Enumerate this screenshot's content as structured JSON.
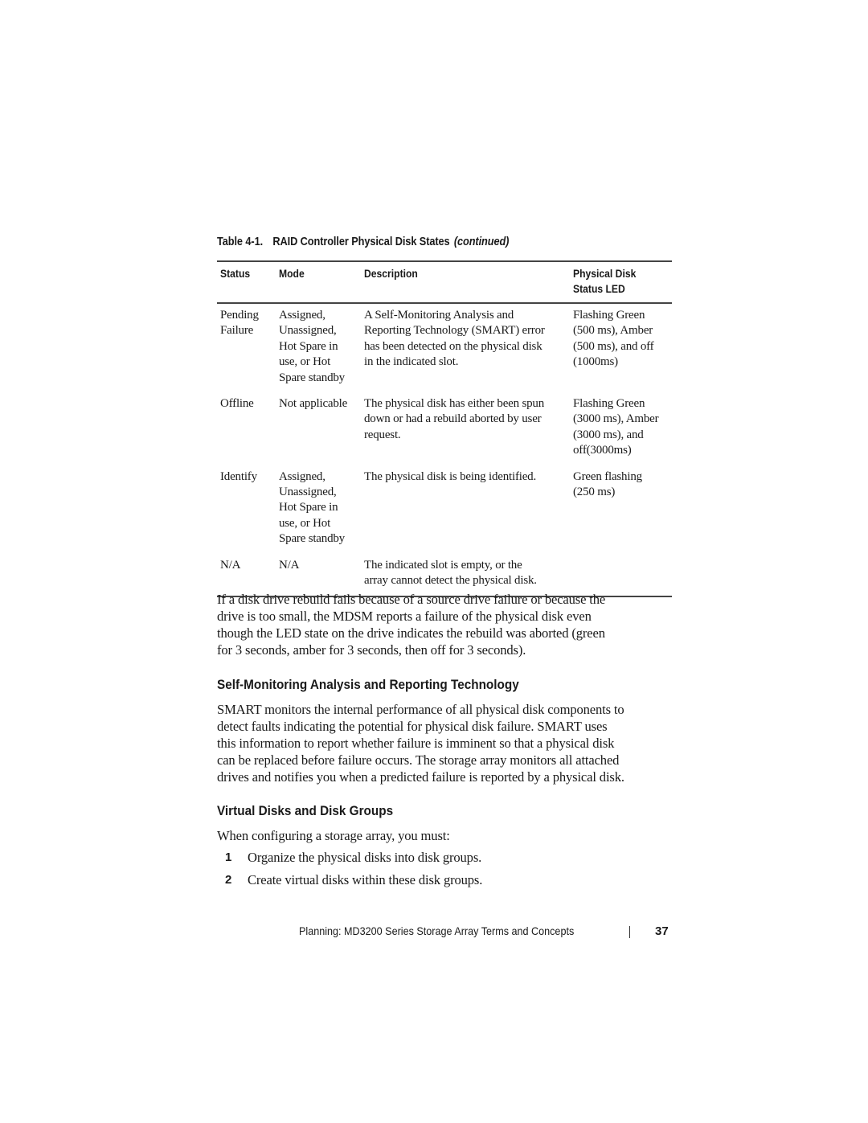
{
  "table": {
    "caption_number": "Table 4-1.",
    "caption_title": "RAID Controller Physical Disk States",
    "caption_continued": "(continued)",
    "headers": {
      "status": "Status",
      "mode": "Mode",
      "description": "Description",
      "led_line1": "Physical Disk",
      "led_line2": "Status LED"
    },
    "rows": [
      {
        "status": [
          "Pending",
          "Failure"
        ],
        "mode": [
          "Assigned,",
          "Unassigned,",
          "Hot Spare in",
          "use, or Hot",
          "Spare standby"
        ],
        "description": [
          "A Self-Monitoring Analysis and",
          "Reporting Technology (SMART) error",
          "has been detected on the physical disk",
          "in the indicated slot."
        ],
        "led": [
          "Flashing Green",
          "(500 ms), Amber",
          "(500 ms), and off",
          "(1000ms)"
        ]
      },
      {
        "status": [
          "Offline"
        ],
        "mode": [
          "Not applicable"
        ],
        "description": [
          "The physical disk has either been spun",
          "down or had a rebuild aborted by user",
          "request."
        ],
        "led": [
          "Flashing Green",
          "(3000 ms), Amber",
          "(3000 ms), and",
          "off(3000ms)"
        ]
      },
      {
        "status": [
          "Identify"
        ],
        "mode": [
          "Assigned,",
          "Unassigned,",
          "Hot Spare in",
          "use, or Hot",
          "Spare standby"
        ],
        "description": [
          "The physical disk is being identified."
        ],
        "led": [
          "Green flashing",
          "(250 ms)"
        ]
      },
      {
        "status": [
          "N/A"
        ],
        "mode": [
          "N/A"
        ],
        "description": [
          "The indicated slot is empty, or the",
          "array cannot detect the physical disk."
        ],
        "led": []
      }
    ]
  },
  "rebuild_paragraph": [
    "If a disk drive rebuild fails because of a source drive failure or because the",
    "drive is too small, the MDSM reports a failure of the physical disk even",
    "though the LED state on the drive indicates the rebuild was aborted (green",
    "for 3 seconds, amber for 3 seconds, then off for 3 seconds)."
  ],
  "smart_section": {
    "heading": "Self-Monitoring Analysis and Reporting Technology",
    "paragraph": [
      "SMART monitors the internal performance of all physical disk components to",
      "detect faults indicating the potential for physical disk failure. SMART uses",
      "this information to report whether failure is imminent so that a physical disk",
      "can be replaced before failure occurs. The storage array monitors all attached",
      "drives and notifies you when a predicted failure is reported by a physical disk."
    ]
  },
  "vd_section": {
    "heading": "Virtual Disks and Disk Groups",
    "intro": "When configuring a storage array, you must:",
    "steps": [
      {
        "num": "1",
        "text": "Organize the physical disks into disk groups."
      },
      {
        "num": "2",
        "text": "Create virtual disks within these disk groups."
      }
    ]
  },
  "footer": {
    "text": "Planning: MD3200 Series Storage Array Terms and Concepts",
    "page_number": "37"
  }
}
